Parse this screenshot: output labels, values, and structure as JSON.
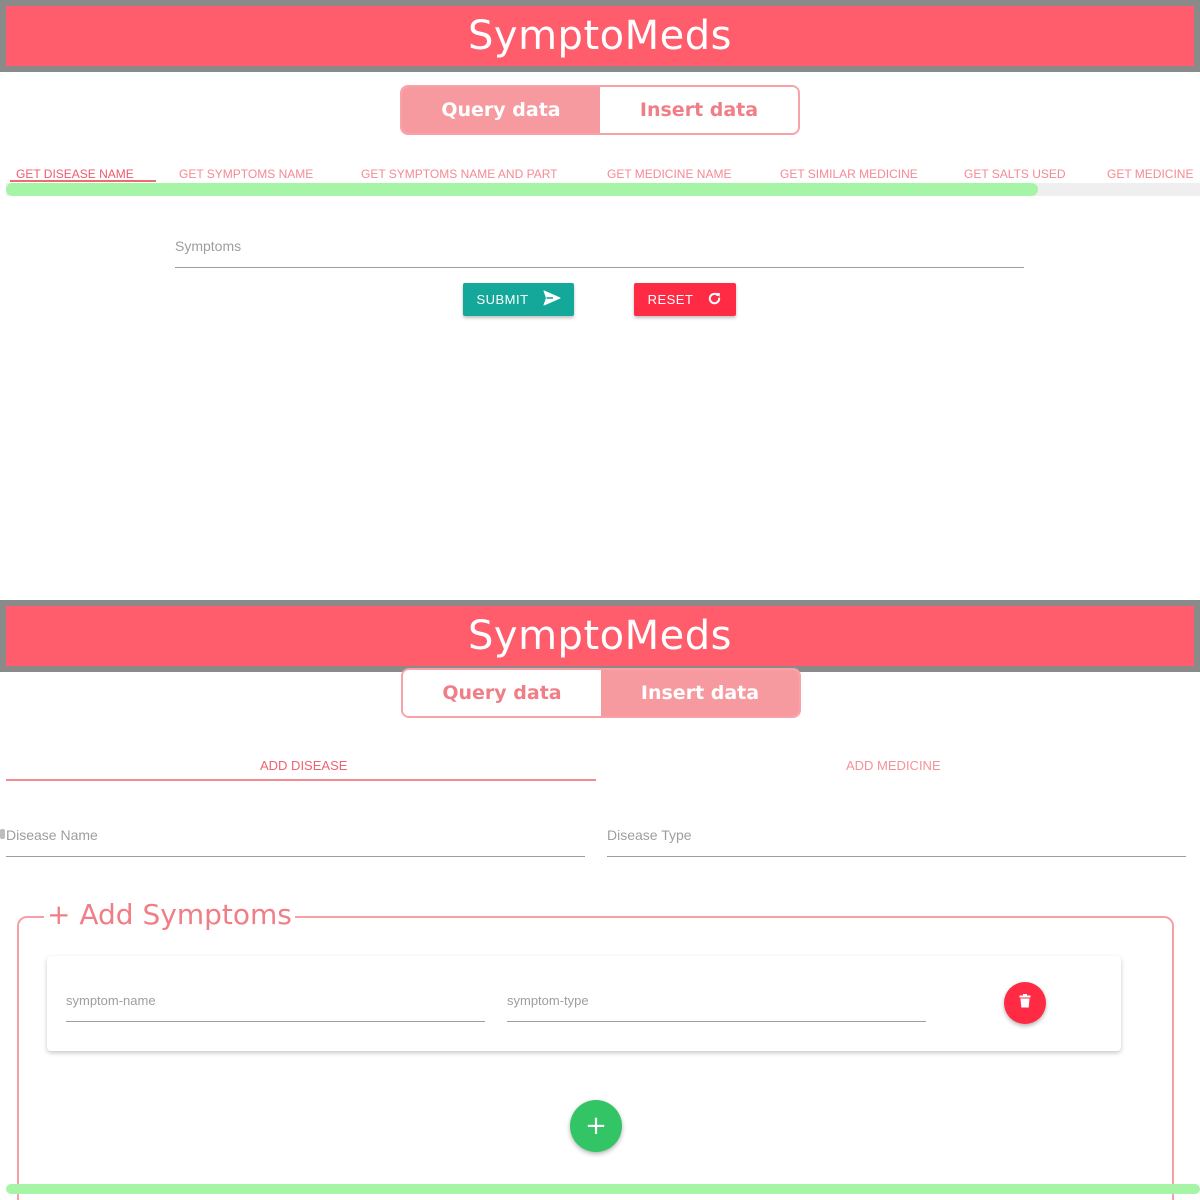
{
  "app": {
    "title": "SymptoMeds"
  },
  "mode_toggle": {
    "query_label": "Query data",
    "insert_label": "Insert data"
  },
  "query_view": {
    "active_mode": "query",
    "tabs": [
      {
        "label": "GET DISEASE NAME",
        "active": true
      },
      {
        "label": "GET SYMPTOMS NAME",
        "active": false
      },
      {
        "label": "GET SYMPTOMS NAME AND PART",
        "active": false
      },
      {
        "label": "GET MEDICINE NAME",
        "active": false
      },
      {
        "label": "GET SIMILAR MEDICINE",
        "active": false
      },
      {
        "label": "GET SALTS USED",
        "active": false
      },
      {
        "label": "GET MEDICINE",
        "active": false
      }
    ],
    "symptoms_input": {
      "placeholder": "Symptoms",
      "value": ""
    },
    "submit_label": "SUBMIT",
    "reset_label": "RESET"
  },
  "insert_view": {
    "active_mode": "insert",
    "tabs": [
      {
        "label": "ADD DISEASE",
        "active": true
      },
      {
        "label": "ADD MEDICINE",
        "active": false
      }
    ],
    "disease_name": {
      "placeholder": "Disease Name",
      "value": ""
    },
    "disease_type": {
      "placeholder": "Disease Type",
      "value": ""
    },
    "symptoms_section": {
      "legend": "+ Add Symptoms"
    },
    "symptom_row": {
      "name_placeholder": "symptom-name",
      "type_placeholder": "symptom-type"
    },
    "add_button_label": "+"
  },
  "icons": {
    "submit": "send-icon",
    "reset": "refresh-icon",
    "delete": "trash-icon"
  },
  "colors": {
    "header": "#ff5c6c",
    "accent": "#f79a9f",
    "submit": "#14a89a",
    "reset": "#ff2a44",
    "add": "#33c565",
    "scrollbar": "#a6f5a6"
  }
}
